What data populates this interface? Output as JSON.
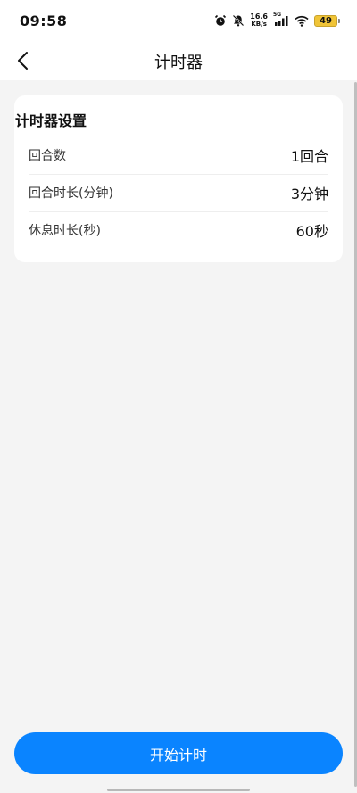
{
  "status_bar": {
    "time": "09:58",
    "net_speed_value": "16.6",
    "net_speed_unit": "KB/s",
    "network_type": "5G",
    "battery_level": "49",
    "icons": [
      "alarm-icon",
      "mute-bell-icon",
      "signal-icon",
      "wifi-icon",
      "battery-icon"
    ]
  },
  "header": {
    "title": "计时器",
    "back_icon": "chevron-left-icon"
  },
  "settings_card": {
    "title": "计时器设置",
    "rows": [
      {
        "label": "回合数",
        "value": "1回合"
      },
      {
        "label": "回合时长(分钟)",
        "value": "3分钟"
      },
      {
        "label": "休息时长(秒)",
        "value": "60秒"
      }
    ]
  },
  "start_button": {
    "label": "开始计时"
  },
  "colors": {
    "accent": "#0a84ff",
    "background": "#f4f4f4",
    "card": "#ffffff",
    "battery": "#f0c437"
  }
}
